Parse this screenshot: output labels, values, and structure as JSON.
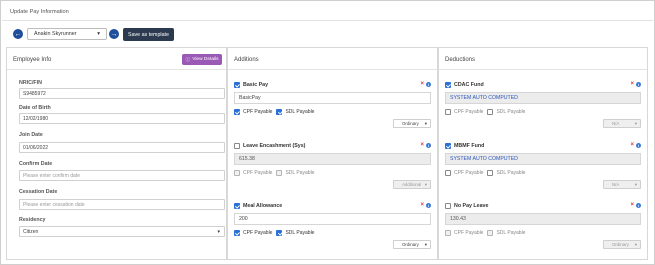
{
  "page": {
    "title": "Update Pay Information"
  },
  "toolbar": {
    "employee": "Anakin Skyrunner",
    "save_template_label": "Save as template"
  },
  "employee_info": {
    "heading": "Employee Info",
    "view_details_label": "View Details",
    "fields": {
      "nric": {
        "label": "NRIC/FIN",
        "value": "S9485972"
      },
      "dob": {
        "label": "Date of Birth",
        "value": "12/02/1980"
      },
      "join": {
        "label": "Join Date",
        "value": "01/06/2022"
      },
      "confirm": {
        "label": "Confirm Date",
        "placeholder": "Please enter confirm date"
      },
      "cessation": {
        "label": "Cessation Date",
        "placeholder": "Please enter cessation date"
      },
      "residency": {
        "label": "Residency",
        "value": "Citizen"
      }
    }
  },
  "additions": {
    "heading": "Additions",
    "items": [
      {
        "name": "Basic Pay",
        "checked": true,
        "value": "BasicPay",
        "cpf": true,
        "sdl": true,
        "cpf_label": "CPF Payable",
        "sdl_label": "SDL Payable",
        "mode": "Ordinary"
      },
      {
        "name": "Leave Encashment (Sys)",
        "checked": false,
        "value": "615.38",
        "cpf": false,
        "sdl": false,
        "cpf_label": "CPF Payable",
        "sdl_label": "SDL Payable",
        "mode": "Additional"
      },
      {
        "name": "Meal Allowance",
        "checked": true,
        "value": "200",
        "cpf": true,
        "sdl": true,
        "cpf_label": "CPF Payable",
        "sdl_label": "SDL Payable",
        "mode": "Ordinary"
      }
    ]
  },
  "deductions": {
    "heading": "Deductions",
    "items": [
      {
        "name": "CDAC Fund",
        "checked": true,
        "value": "SYSTEM AUTO COMPUTED",
        "cpf": false,
        "sdl": false,
        "cpf_label": "CPF Payable",
        "sdl_label": "SDL Payable",
        "mode": "N/A"
      },
      {
        "name": "MBMF Fund",
        "checked": true,
        "value": "SYSTEM AUTO COMPUTED",
        "cpf": false,
        "sdl": false,
        "cpf_label": "CPF Payable",
        "sdl_label": "SDL Payable",
        "mode": "N/A"
      },
      {
        "name": "No Pay Leave",
        "checked": false,
        "value": "130.43",
        "cpf": false,
        "sdl": false,
        "cpf_label": "CPF Payable",
        "sdl_label": "SDL Payable",
        "mode": "Ordinary"
      }
    ]
  },
  "colors": {
    "primary": "#1e4f9c",
    "purple_button": "#9b59b6",
    "dark_button": "#2b3a4f",
    "remove": "#e03b3b",
    "info": "#3a78d6",
    "auto_text": "#2c55b8"
  },
  "icons": {
    "prev": "arrow-left-circle-icon",
    "next": "arrow-right-circle-icon",
    "remove": "close-icon",
    "info": "info-icon",
    "dropdown": "chevron-down-icon"
  }
}
